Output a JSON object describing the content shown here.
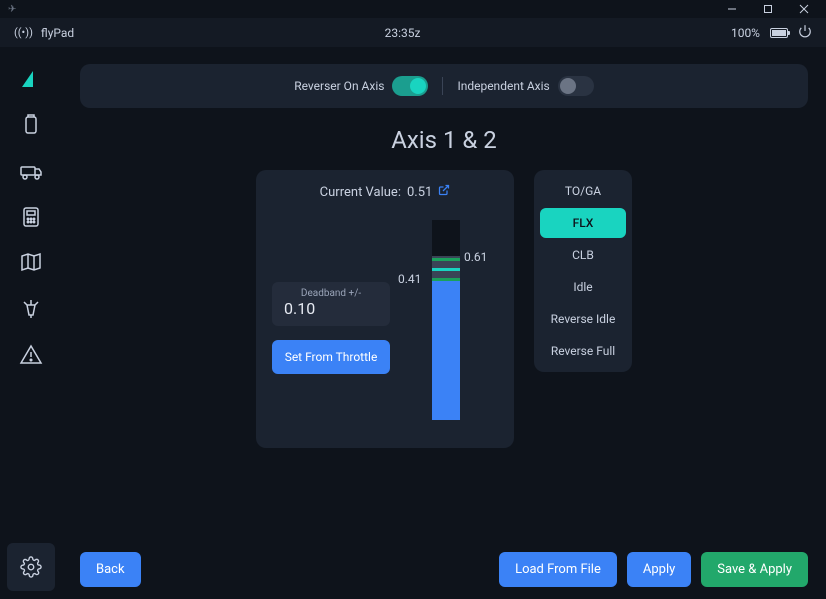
{
  "titlebar": {
    "app_icon": "app"
  },
  "statusbar": {
    "app_name": "flyPad",
    "time": "23:35z",
    "battery_pct": "100%"
  },
  "toggles": {
    "reverser_label": "Reverser On Axis",
    "reverser_on": true,
    "independent_label": "Independent Axis",
    "independent_on": false
  },
  "page": {
    "title": "Axis 1 & 2"
  },
  "axis": {
    "current_label": "Current Value:",
    "current_value": "0.51",
    "deadband_label": "Deadband +/-",
    "deadband_value": "0.10",
    "set_from_throttle": "Set From Throttle",
    "upper_tick": "0.61",
    "lower_tick": "0.41",
    "fill_pct": 70,
    "band_top_pct": 18,
    "band_height_pct": 12
  },
  "detents": {
    "items": [
      "TO/GA",
      "FLX",
      "CLB",
      "Idle",
      "Reverse Idle",
      "Reverse Full"
    ],
    "active_index": 1
  },
  "footer": {
    "back": "Back",
    "load": "Load From File",
    "apply": "Apply",
    "save_apply": "Save & Apply"
  }
}
